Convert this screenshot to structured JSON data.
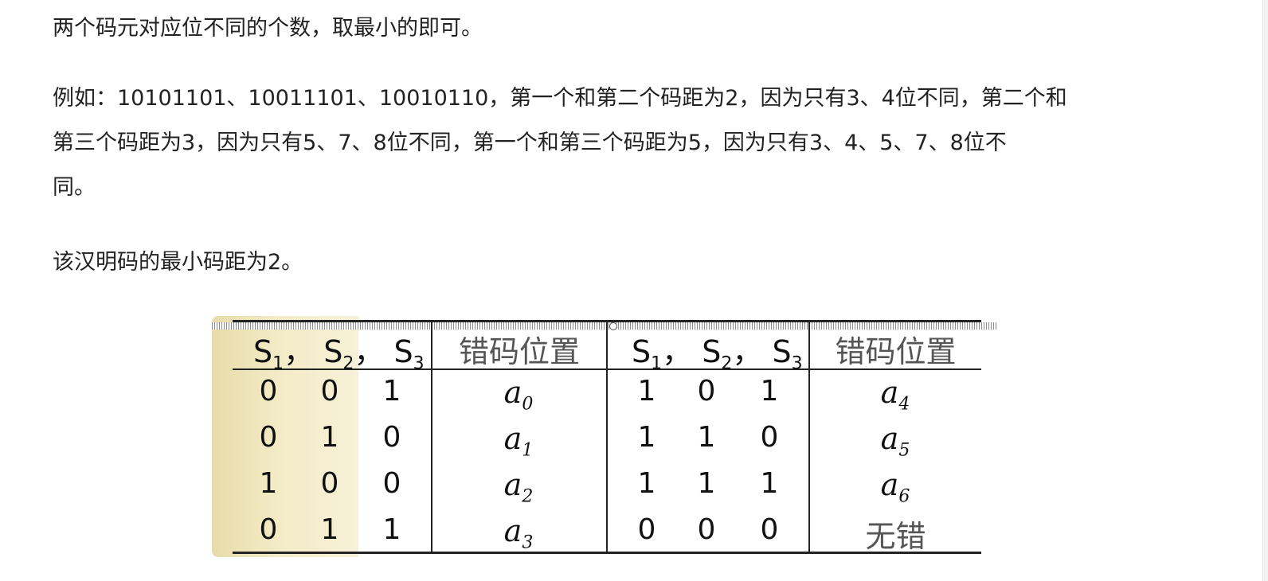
{
  "paragraphs": {
    "p1": "两个码元对应位不同的个数，取最小的即可。",
    "p2": "例如：10101101、10011101、10010110，第一个和第二个码距为2，因为只有3、4位不同，第二个和\n第三个码距为3，因为只有5、7、8位不同，第一个和第三个码距为5，因为只有3、4、5、7、8位不\n同。",
    "p3": "该汉明码的最小码距为2。"
  },
  "table": {
    "s_header": {
      "s": "S",
      "sub1": "1",
      "sub2": "2",
      "sub3": "3",
      "comma": "，"
    },
    "position_header": "错码位置",
    "a_symbol": "a",
    "left_rows": [
      {
        "s1": "0",
        "s2": "0",
        "s3": "1",
        "sub": "0"
      },
      {
        "s1": "0",
        "s2": "1",
        "s3": "0",
        "sub": "1"
      },
      {
        "s1": "1",
        "s2": "0",
        "s3": "0",
        "sub": "2"
      },
      {
        "s1": "0",
        "s2": "1",
        "s3": "1",
        "sub": "3"
      }
    ],
    "right_rows": [
      {
        "s1": "1",
        "s2": "0",
        "s3": "1",
        "sub": "4",
        "text": ""
      },
      {
        "s1": "1",
        "s2": "1",
        "s3": "0",
        "sub": "5",
        "text": ""
      },
      {
        "s1": "1",
        "s2": "1",
        "s3": "1",
        "sub": "6",
        "text": ""
      },
      {
        "s1": "0",
        "s2": "0",
        "s3": "0",
        "sub": "",
        "text": "无错"
      }
    ]
  }
}
